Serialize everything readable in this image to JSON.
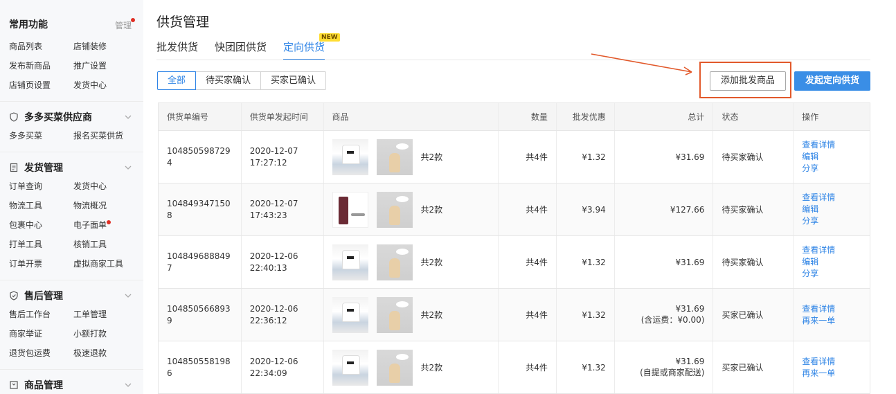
{
  "sidebar": {
    "common": {
      "title": "常用功能",
      "manage": "管理",
      "items": [
        "商品列表",
        "店铺装修",
        "发布新商品",
        "推广设置",
        "店铺页设置",
        "发货中心"
      ]
    },
    "sections": [
      {
        "title": "多多买菜供应商",
        "icon": "shield-icon",
        "items": [
          "多多买菜",
          "报名买菜供货"
        ]
      },
      {
        "title": "发货管理",
        "icon": "document-icon",
        "items": [
          "订单查询",
          "发货中心",
          "物流工具",
          "物流概况",
          "包裹中心",
          "电子面单",
          "打单工具",
          "核销工具",
          "订单开票",
          "虚拟商家工具"
        ]
      },
      {
        "title": "售后管理",
        "icon": "shield-check-icon",
        "items": [
          "售后工作台",
          "工单管理",
          "商家举证",
          "小额打款",
          "退货包运费",
          "极速退款"
        ]
      },
      {
        "title": "商品管理",
        "icon": "box-icon",
        "items": []
      }
    ]
  },
  "page": {
    "title": "供货管理",
    "tabs": [
      "批发供货",
      "快团团供货",
      "定向供货"
    ],
    "tab_new_badge": "NEW",
    "filters": [
      "全部",
      "待买家确认",
      "买家已确认"
    ],
    "add_button": "添加批发商品",
    "primary_button": "发起定向供货"
  },
  "table": {
    "headers": [
      "供货单编号",
      "供货单发起时间",
      "商品",
      "数量",
      "批发优惠",
      "总计",
      "状态",
      "操作"
    ],
    "rows": [
      {
        "id": "1048505987294",
        "date": "2020-12-07",
        "time": "17:27:12",
        "kinds": "共2款",
        "qty": "共4件",
        "discount": "¥1.32",
        "total": "¥31.69",
        "total_note": "",
        "status": "待买家确认",
        "ops": [
          "查看详情",
          "编辑",
          "分享"
        ]
      },
      {
        "id": "1048493471508",
        "date": "2020-12-07",
        "time": "17:43:23",
        "kinds": "共2款",
        "qty": "共4件",
        "discount": "¥3.94",
        "total": "¥127.66",
        "total_note": "",
        "status": "待买家确认",
        "ops": [
          "查看详情",
          "编辑",
          "分享"
        ]
      },
      {
        "id": "1048496888497",
        "date": "2020-12-06",
        "time": "22:40:13",
        "kinds": "共2款",
        "qty": "共4件",
        "discount": "¥1.32",
        "total": "¥31.69",
        "total_note": "",
        "status": "待买家确认",
        "ops": [
          "查看详情",
          "编辑",
          "分享"
        ]
      },
      {
        "id": "1048505668939",
        "date": "2020-12-06",
        "time": "22:36:12",
        "kinds": "共2款",
        "qty": "共4件",
        "discount": "¥1.32",
        "total": "¥31.69",
        "total_note": "(含运费：¥0.00)",
        "status": "买家已确认",
        "ops": [
          "查看详情",
          "再来一单"
        ]
      },
      {
        "id": "1048505581986",
        "date": "2020-12-06",
        "time": "22:34:09",
        "kinds": "共2款",
        "qty": "共4件",
        "discount": "¥1.32",
        "total": "¥31.69",
        "total_note": "(自提或商家配送)",
        "status": "买家已确认",
        "ops": [
          "查看详情",
          "再来一单"
        ]
      }
    ]
  },
  "colors": {
    "accent": "#2e84e6",
    "highlight": "#e2592b",
    "badge": "#ffdd33"
  }
}
